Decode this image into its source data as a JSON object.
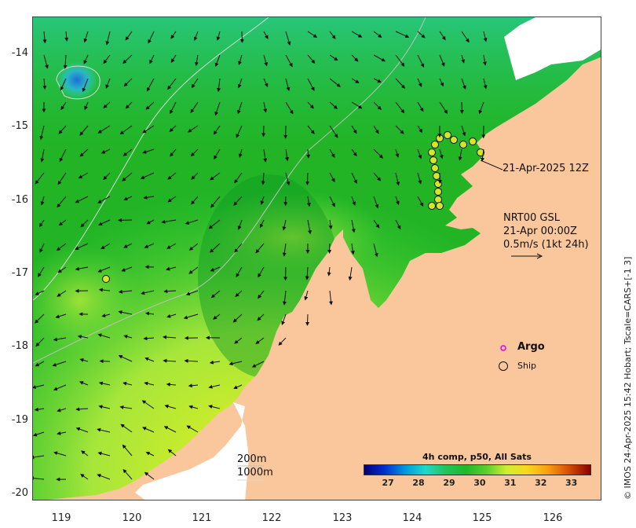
{
  "map": {
    "lon_range": [
      118.6,
      126.7
    ],
    "lat_range": [
      -20.1,
      -13.5
    ],
    "land_color": "#f9c79b",
    "sea_colors": [
      "#0d8c1f",
      "#22b425",
      "#3fd23a",
      "#8fe34f",
      "#c8ef3a",
      "#e8f020",
      "#2fd6a8"
    ],
    "y_ticks": [
      "-14",
      "-15",
      "-16",
      "-17",
      "-18",
      "-19",
      "-20"
    ],
    "x_ticks": [
      "119",
      "120",
      "121",
      "122",
      "123",
      "124",
      "125",
      "126"
    ]
  },
  "annotations": {
    "ship_track_label": "21-Apr-2025 12Z",
    "current_block": {
      "line1": "NRT00 GSL",
      "line2": "21-Apr 00:00Z",
      "line3": "0.5m/s (1kt 24h)"
    },
    "contour_labels": {
      "shallow": "200m",
      "deep": "1000m"
    }
  },
  "legend": {
    "argo_label": "Argo",
    "ship_label": "Ship",
    "colorbar_title": "4h comp, p50, All Sats",
    "colorbar_ticks": [
      "27",
      "28",
      "29",
      "30",
      "31",
      "32",
      "33"
    ],
    "colorbar_range": [
      26.2,
      33.6
    ]
  },
  "credit": "© IMOS 24-Apr-2025 15:42 Hobart; Tscale=CARS+[-1 3]"
}
